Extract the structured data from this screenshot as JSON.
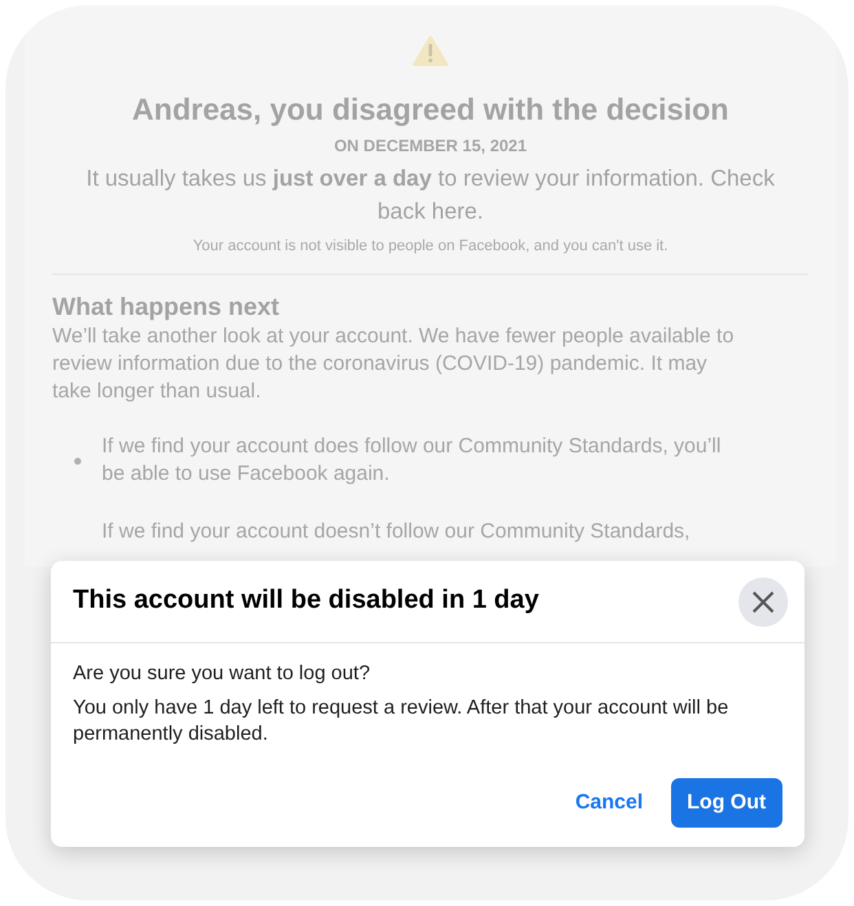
{
  "page": {
    "title": "Andreas, you disagreed with the decision",
    "date": "ON DECEMBER 15, 2021",
    "message": "It usually takes us **just over a day** to review your information. Check back here.",
    "note": "Your account is not visible to people on Facebook, and you can't use it.",
    "section_heading": "What happens next",
    "section_text": "We’ll take another look at your account. We have fewer people available to review information due to the coronavirus (COVID-19) pandemic. It may take longer than usual.",
    "bullets": [
      {
        "text": "If we find your account does follow our Community Standards, you’ll be able to use Facebook again.",
        "marker": true
      },
      {
        "text": "If we find your account doesn’t follow our Community Standards,",
        "marker": false
      }
    ]
  },
  "dialog": {
    "title": "This account will be disabled in 1 day",
    "question": "Are you sure you want to log out?",
    "message": "You only have 1 day left to request a review. After that your account will be permanently disabled.",
    "buttons": [
      {
        "label": "Cancel",
        "kind": "text"
      },
      {
        "label": "Log Out",
        "kind": "primary"
      }
    ]
  }
}
